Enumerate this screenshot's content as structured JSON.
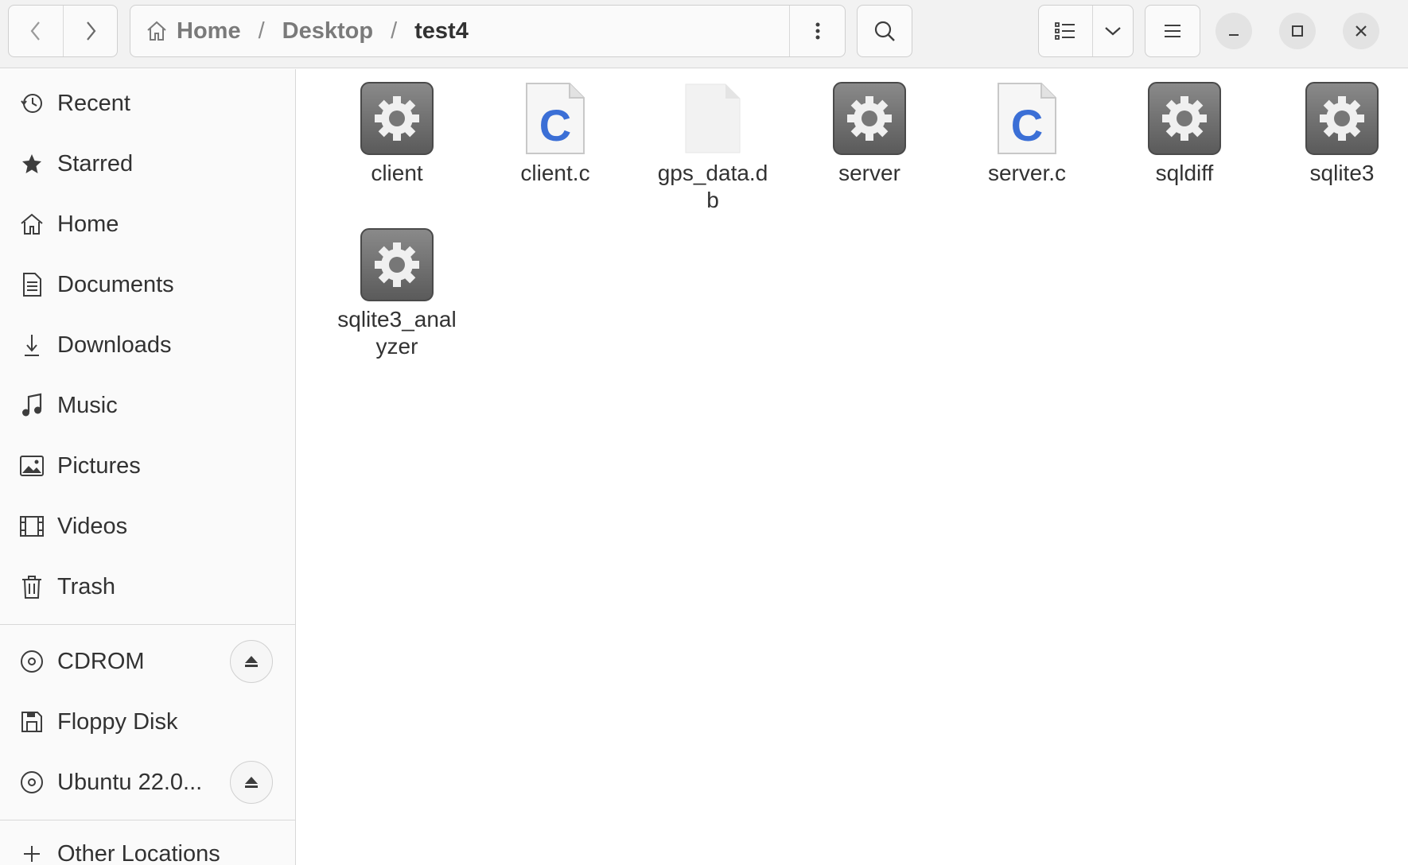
{
  "window": {
    "breadcrumb": [
      "Home",
      "Desktop",
      "test4"
    ]
  },
  "header": {
    "back_icon": "chevron-left-icon",
    "forward_icon": "chevron-right-icon",
    "path_menu_icon": "vertical-dots-icon",
    "search_icon": "search-icon",
    "view_icon": "list-view-icon",
    "view_dropdown_icon": "chevron-down-icon",
    "menu_icon": "hamburger-icon",
    "minimize_icon": "minimize-icon",
    "maximize_icon": "maximize-icon",
    "close_icon": "close-icon"
  },
  "sidebar": {
    "places": [
      {
        "label": "Recent",
        "icon": "recent-icon"
      },
      {
        "label": "Starred",
        "icon": "star-icon"
      },
      {
        "label": "Home",
        "icon": "home-icon"
      },
      {
        "label": "Documents",
        "icon": "document-icon"
      },
      {
        "label": "Downloads",
        "icon": "download-icon"
      },
      {
        "label": "Music",
        "icon": "music-icon"
      },
      {
        "label": "Pictures",
        "icon": "picture-icon"
      },
      {
        "label": "Videos",
        "icon": "video-icon"
      },
      {
        "label": "Trash",
        "icon": "trash-icon"
      }
    ],
    "devices": [
      {
        "label": "CDROM",
        "icon": "disc-icon",
        "ejectable": true
      },
      {
        "label": "Floppy Disk",
        "icon": "floppy-icon",
        "ejectable": false
      },
      {
        "label": "Ubuntu 22.0...",
        "icon": "disc-icon",
        "ejectable": true
      }
    ],
    "other": {
      "label": "Other Locations",
      "icon": "plus-icon"
    }
  },
  "files": [
    {
      "name": "client",
      "type": "executable",
      "icon": "gear-icon"
    },
    {
      "name": "client.c",
      "type": "c-source",
      "icon": "c-file-icon"
    },
    {
      "name": "gps_data.db",
      "type": "generic",
      "icon": "blank-file-icon"
    },
    {
      "name": "server",
      "type": "executable",
      "icon": "gear-icon"
    },
    {
      "name": "server.c",
      "type": "c-source",
      "icon": "c-file-icon"
    },
    {
      "name": "sqldiff",
      "type": "executable",
      "icon": "gear-icon"
    },
    {
      "name": "sqlite3",
      "type": "executable",
      "icon": "gear-icon"
    },
    {
      "name": "sqlite3_analyzer",
      "type": "executable",
      "icon": "gear-icon"
    }
  ],
  "colors": {
    "header_bg": "#f2f2f2",
    "sidebar_bg": "#fafafa",
    "c_letter": "#3b6fd6",
    "exec_icon": "#6a6a6a"
  }
}
